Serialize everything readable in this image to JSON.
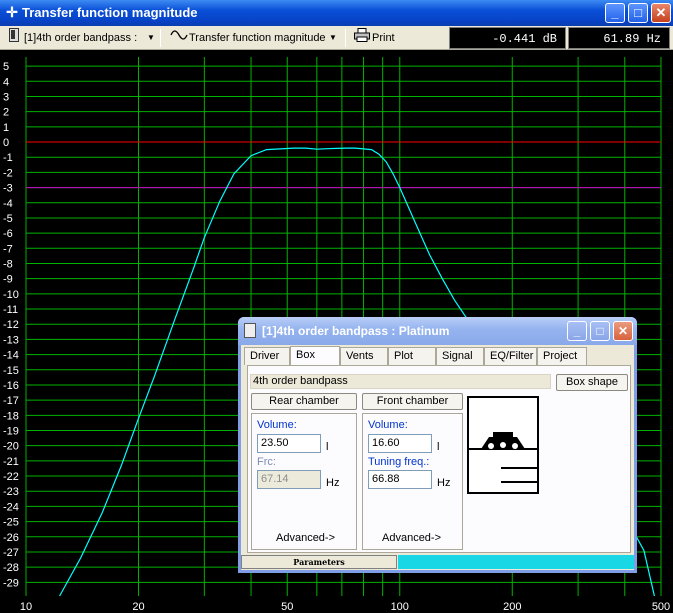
{
  "window": {
    "title": "Transfer function magnitude",
    "buttons": {
      "minimize": "_",
      "maximize": "□",
      "close": "✕"
    }
  },
  "toolbar": {
    "project_select": "[1]4th order bandpass :",
    "plot_select": "Transfer function magnitude",
    "print_label": "Print",
    "readout_db": "-0.441 dB",
    "readout_hz": "61.89 Hz"
  },
  "plot": {
    "y_ticks": [
      "5",
      "4",
      "3",
      "2",
      "1",
      "0",
      "-1",
      "-2",
      "-3",
      "-4",
      "-5",
      "-6",
      "-7",
      "-8",
      "-9",
      "-10",
      "-11",
      "-12",
      "-13",
      "-14",
      "-15",
      "-16",
      "-17",
      "-18",
      "-19",
      "-20",
      "-21",
      "-22",
      "-23",
      "-24",
      "-25",
      "-26",
      "-27",
      "-28",
      "-29"
    ],
    "x_ticks": [
      "10",
      "20",
      "50",
      "100",
      "200",
      "500"
    ],
    "colors": {
      "background": "#000000",
      "grid": "#00b200",
      "curve": "#00ffff",
      "zero_line": "#ff0000",
      "minus3_line": "#cc00cc",
      "text": "#ffffff"
    }
  },
  "chart_data": {
    "type": "line",
    "title": "",
    "xlabel": "",
    "ylabel": "",
    "x_scale": "log",
    "xlim": [
      10,
      500
    ],
    "ylim": [
      -29.9,
      5.6
    ],
    "grid": true,
    "series": [
      {
        "x": [
          12.3,
          14,
          16,
          18,
          20,
          22,
          25,
          28,
          30,
          33,
          36,
          40,
          44,
          48,
          52,
          56,
          60,
          64,
          68,
          72,
          76,
          80,
          84,
          88,
          92,
          96,
          100,
          110,
          120,
          130,
          140,
          150,
          170,
          200,
          250,
          300,
          350,
          400,
          450,
          480
        ],
        "y": [
          -29.9,
          -27.4,
          -24.4,
          -21.3,
          -18.2,
          -15.5,
          -11.7,
          -8.4,
          -6.3,
          -3.9,
          -2.1,
          -0.9,
          -0.5,
          -0.45,
          -0.4,
          -0.4,
          -0.47,
          -0.44,
          -0.42,
          -0.4,
          -0.4,
          -0.45,
          -0.5,
          -0.8,
          -1.3,
          -2.1,
          -3.0,
          -5.3,
          -7.4,
          -9.0,
          -10.4,
          -11.5,
          -13.4,
          -15.6,
          -18.5,
          -20.8,
          -22.6,
          -24.6,
          -26.9,
          -29.9
        ]
      }
    ],
    "reference_lines": [
      {
        "y": 0,
        "color": "#ff0000"
      },
      {
        "y": -3,
        "color": "#cc00cc"
      }
    ]
  },
  "child": {
    "title": "[1]4th order bandpass : Platinum",
    "tabs": [
      "Driver",
      "Box",
      "Vents",
      "Plot",
      "Signal",
      "EQ/Filter",
      "Project"
    ],
    "active_tab": "Box",
    "box_type": "4th order bandpass",
    "box_shape_label": "Box shape",
    "rear": {
      "header": "Rear chamber",
      "volume_label": "Volume:",
      "volume_value": "23.50",
      "volume_unit": "l",
      "frc_label": "Frc:",
      "frc_value": "67.14",
      "frc_unit": "Hz",
      "advanced": "Advanced->"
    },
    "front": {
      "header": "Front chamber",
      "volume_label": "Volume:",
      "volume_value": "16.60",
      "volume_unit": "l",
      "tuning_label": "Tuning freq.:",
      "tuning_value": "66.88",
      "tuning_unit": "Hz",
      "advanced": "Advanced->"
    },
    "status": "Parameters",
    "progress_fraction": 1.0
  }
}
